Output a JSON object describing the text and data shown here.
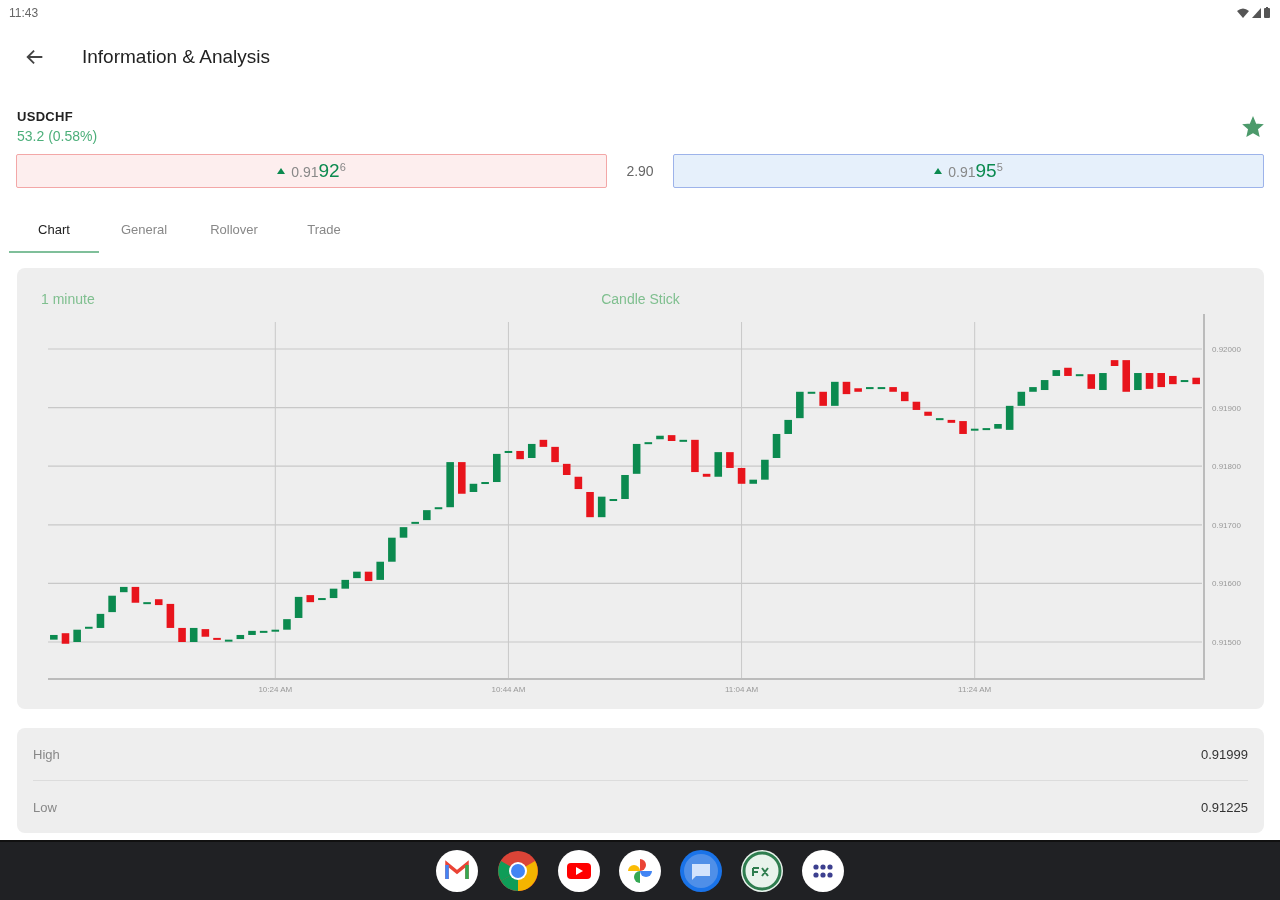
{
  "status_bar": {
    "time": "11:43"
  },
  "app_bar": {
    "title": "Information & Analysis"
  },
  "instrument": {
    "symbol": "USDCHF",
    "change": "53.2 (0.58%)",
    "favorite": true
  },
  "quotes": {
    "sell": {
      "prefix": "0.91",
      "big": "92",
      "pip": "6",
      "rising": true
    },
    "spread": "2.90",
    "buy": {
      "prefix": "0.91",
      "big": "95",
      "pip": "5",
      "rising": true
    }
  },
  "tabs": [
    {
      "label": "Chart",
      "selected": true
    },
    {
      "label": "General",
      "selected": false
    },
    {
      "label": "Rollover",
      "selected": false
    },
    {
      "label": "Trade",
      "selected": false
    }
  ],
  "chart": {
    "interval": "1 minute",
    "style": "Candle Stick",
    "x_labels": [
      "10:24 AM",
      "10:44 AM",
      "11:04 AM",
      "11:24 AM"
    ],
    "y_labels": [
      "0.92000",
      "0.91900",
      "0.91800",
      "0.91700",
      "0.91600",
      "0.91500"
    ]
  },
  "stats": [
    {
      "label": "High",
      "value": "0.91999"
    },
    {
      "label": "Low",
      "value": "0.91225"
    }
  ]
}
